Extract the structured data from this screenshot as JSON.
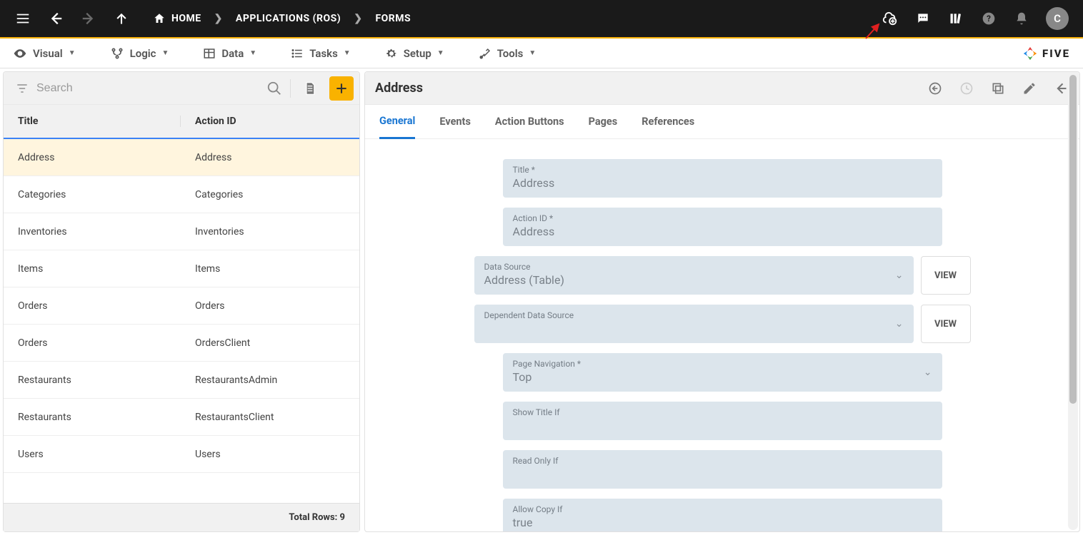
{
  "topbar": {
    "breadcrumbs": [
      {
        "label": "HOME",
        "icon": "home"
      },
      {
        "label": "APPLICATIONS (ROS)"
      },
      {
        "label": "FORMS"
      }
    ],
    "avatar_letter": "C"
  },
  "menubar": {
    "items": [
      {
        "label": "Visual",
        "icon": "eye"
      },
      {
        "label": "Logic",
        "icon": "branch"
      },
      {
        "label": "Data",
        "icon": "table"
      },
      {
        "label": "Tasks",
        "icon": "list"
      },
      {
        "label": "Setup",
        "icon": "gear"
      },
      {
        "label": "Tools",
        "icon": "wrench"
      }
    ],
    "logo_text": "FIVE"
  },
  "left_panel": {
    "search_placeholder": "Search",
    "columns": {
      "title": "Title",
      "action_id": "Action ID"
    },
    "rows": [
      {
        "title": "Address",
        "action_id": "Address",
        "selected": true
      },
      {
        "title": "Categories",
        "action_id": "Categories"
      },
      {
        "title": "Inventories",
        "action_id": "Inventories"
      },
      {
        "title": "Items",
        "action_id": "Items"
      },
      {
        "title": "Orders",
        "action_id": "Orders"
      },
      {
        "title": "Orders",
        "action_id": "OrdersClient"
      },
      {
        "title": "Restaurants",
        "action_id": "RestaurantsAdmin"
      },
      {
        "title": "Restaurants",
        "action_id": "RestaurantsClient"
      },
      {
        "title": "Users",
        "action_id": "Users"
      }
    ],
    "footer": "Total Rows: 9"
  },
  "right_panel": {
    "title": "Address",
    "tabs": [
      "General",
      "Events",
      "Action Buttons",
      "Pages",
      "References"
    ],
    "active_tab": 0,
    "view_button_label": "VIEW",
    "fields": [
      {
        "label": "Title *",
        "value": "Address"
      },
      {
        "label": "Action ID *",
        "value": "Address"
      },
      {
        "label": "Data Source",
        "value": "Address (Table)",
        "dropdown": true,
        "view": true
      },
      {
        "label": "Dependent Data Source",
        "value": "",
        "dropdown": true,
        "view": true
      },
      {
        "label": "Page Navigation *",
        "value": "Top",
        "dropdown": true
      },
      {
        "label": "Show Title If",
        "value": ""
      },
      {
        "label": "Read Only If",
        "value": ""
      },
      {
        "label": "Allow Copy If",
        "value": "true"
      }
    ]
  }
}
